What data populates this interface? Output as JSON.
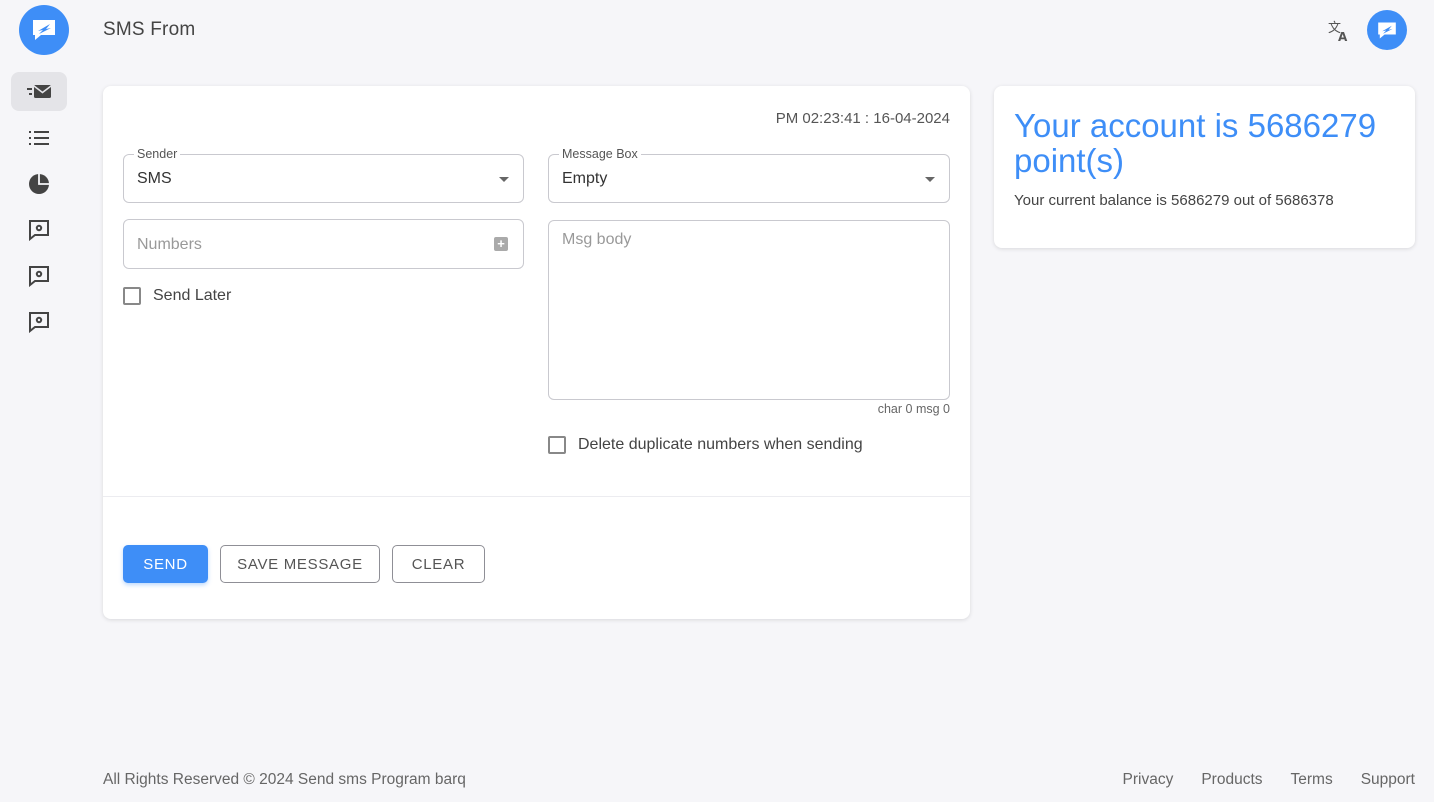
{
  "header": {
    "title": "SMS From",
    "logo_icon": "chat-bubble-logo-icon",
    "translate_icon": "translate-icon",
    "avatar_icon": "chat-bubble-logo-icon"
  },
  "sidebar": {
    "items": [
      {
        "name": "send-sms",
        "icon": "fast-mail-icon",
        "active": true
      },
      {
        "name": "list",
        "icon": "list-icon",
        "active": false
      },
      {
        "name": "reports",
        "icon": "pie-chart-icon",
        "active": false
      },
      {
        "name": "settings-1",
        "icon": "message-settings-icon",
        "active": false
      },
      {
        "name": "settings-2",
        "icon": "message-settings-icon",
        "active": false
      },
      {
        "name": "settings-3",
        "icon": "message-settings-icon",
        "active": false
      }
    ]
  },
  "form": {
    "timestamp": "PM 02:23:41 : 16-04-2024",
    "sender": {
      "label": "Sender",
      "value": "SMS"
    },
    "message_box": {
      "label": "Message Box",
      "value": "Empty"
    },
    "numbers": {
      "placeholder": "Numbers"
    },
    "msg_body": {
      "placeholder": "Msg body"
    },
    "send_later": "Send Later",
    "counter": "char 0 msg 0",
    "delete_duplicates": "Delete duplicate numbers when sending",
    "buttons": {
      "send": "SEND",
      "save": "SAVE MESSAGE",
      "clear": "CLEAR"
    }
  },
  "account": {
    "title": "Your account is 5686279 point(s)",
    "balance": "Your current balance is 5686279 out of 5686378"
  },
  "footer": {
    "copyright": "All Rights Reserved © 2024 Send sms Program barq",
    "links": [
      "Privacy",
      "Products",
      "Terms",
      "Support"
    ]
  },
  "colors": {
    "accent": "#3e8ef7",
    "background": "#f6f6f9"
  }
}
